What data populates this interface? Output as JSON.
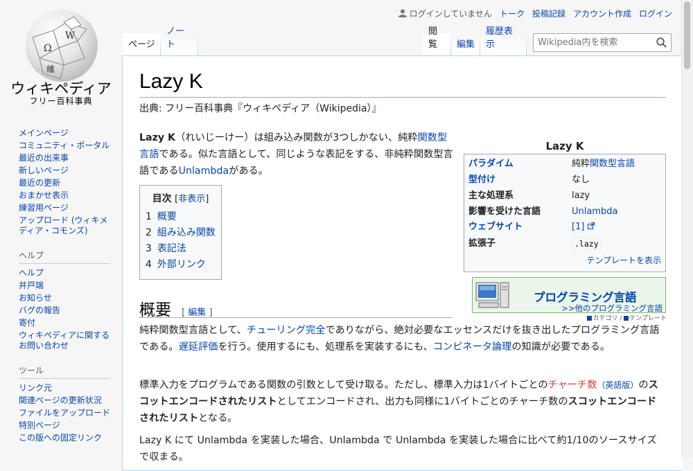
{
  "logo": {
    "wordmark": "ウィキペディア",
    "tagline": "フリー百科事典",
    "globe_glyphs": [
      "Ω",
      "W",
      "維"
    ]
  },
  "personal": {
    "not_logged_in": "ログインしていません",
    "talk": "トーク",
    "contributions": "投稿記録",
    "create_account": "アカウント作成",
    "login": "ログイン"
  },
  "tabs": {
    "page": "ページ",
    "note": "ノート",
    "read": "閲覧",
    "edit": "編集",
    "history": "履歴表示"
  },
  "search": {
    "placeholder": "Wikipedia内を検索"
  },
  "sidebar": {
    "nav": [
      {
        "label": "メインページ"
      },
      {
        "label": "コミュニティ・ポータル"
      },
      {
        "label": "最近の出来事"
      },
      {
        "label": "新しいページ"
      },
      {
        "label": "最近の更新"
      },
      {
        "label": "おまかせ表示"
      },
      {
        "label": "練習用ページ"
      },
      {
        "label": "アップロード (ウィキメディア・コモンズ)"
      }
    ],
    "help_heading": "ヘルプ",
    "help": [
      {
        "label": "ヘルプ"
      },
      {
        "label": "井戸端"
      },
      {
        "label": "お知らせ"
      },
      {
        "label": "バグの報告"
      },
      {
        "label": "寄付"
      },
      {
        "label": "ウィキペディアに関するお問い合わせ"
      }
    ],
    "tools_heading": "ツール",
    "tools": [
      {
        "label": "リンク元"
      },
      {
        "label": "関連ページの更新状況"
      },
      {
        "label": "ファイルをアップロード"
      },
      {
        "label": "特別ページ"
      },
      {
        "label": "この版への固定リンク"
      }
    ]
  },
  "article": {
    "title": "Lazy K",
    "site_sub": "出典: フリー百科事典『ウィキペディア（Wikipedia）』",
    "intro": {
      "bold": "Lazy K",
      "t1": "（れいじーけー）は組み込み関数が3つしかない、純粋",
      "link1": "関数型言語",
      "t2": "である。似た言語として、同じような表記をする、非純粋関数型言語である",
      "link2": "Unlambda",
      "t3": "がある。"
    },
    "toc": {
      "title": "目次",
      "toggle_open": "[",
      "toggle": "非表示",
      "toggle_close": "]",
      "items": [
        {
          "num": "1",
          "label": "概要"
        },
        {
          "num": "2",
          "label": "組み込み関数"
        },
        {
          "num": "3",
          "label": "表記法"
        },
        {
          "num": "4",
          "label": "外部リンク"
        }
      ]
    },
    "section_overview": {
      "heading": "概要",
      "edit_open": "[ ",
      "edit": "編集",
      "edit_close": " ]"
    },
    "p1": {
      "t1": "純粋関数型言語として、",
      "link1": "チューリング完全",
      "t2": "でありながら、絶対必要なエッセンスだけを抜き出したプログラミング言語である。",
      "link2": "遅延評価",
      "t3": "を行う。使用するにも、処理系を実装するにも、",
      "link3": "コンピネータ論理",
      "t4": "の知識が必要である。"
    },
    "p2": {
      "t1": "標準入力をプログラムである関数の引数として受け取る。ただし、標準入力は1バイトごとの",
      "redlink": "チャーチ数",
      "small_link": "（英語版）",
      "t2": "の",
      "bold1": "スコットエンコードされたリスト",
      "t3": "としてエンコードされ、出力も同様に1バイトごとのチャーチ数の",
      "bold2": "スコットエンコードされたリスト",
      "t4": "となる。"
    },
    "p3": "Lazy K にて Unlambda を実装した場合、Unlambda で Unlambda を実装した場合に比べて約1/10のソースサイズで収まる。"
  },
  "infobox": {
    "title": "Lazy K",
    "rows": [
      {
        "label": "パラダイム",
        "label_link": true,
        "value_prefix": "純粋",
        "value": "関数型言語",
        "value_link": true
      },
      {
        "label": "型付け",
        "label_link": true,
        "value_prefix": "",
        "value": "なし",
        "value_link": false
      },
      {
        "label": "主な処理系",
        "label_link": false,
        "value_prefix": "",
        "value": "lazy",
        "value_link": false
      },
      {
        "label": "影響を受けた言語",
        "label_link": false,
        "value_prefix": "",
        "value": "Unlambda",
        "value_link": true
      },
      {
        "label": "ウェブサイト",
        "label_link": true,
        "value_prefix": "",
        "value": "[1]",
        "value_link": true
      },
      {
        "label": "拡張子",
        "label_link": false,
        "value_prefix": "",
        "value": ".lazy",
        "value_link": false
      }
    ],
    "template_link": "テンプレートを表示"
  },
  "portal": {
    "title": "プログラミング言語",
    "other": ">>他のプログラミング言語",
    "nav_category": "カテゴリ",
    "nav_sep": " / ",
    "nav_template": "テンプレート"
  },
  "colors": {
    "link": "#0645ad",
    "redlink": "#d33",
    "portal_bg": "#eaf6ea",
    "infobox_bg": "#f8f9fa"
  }
}
